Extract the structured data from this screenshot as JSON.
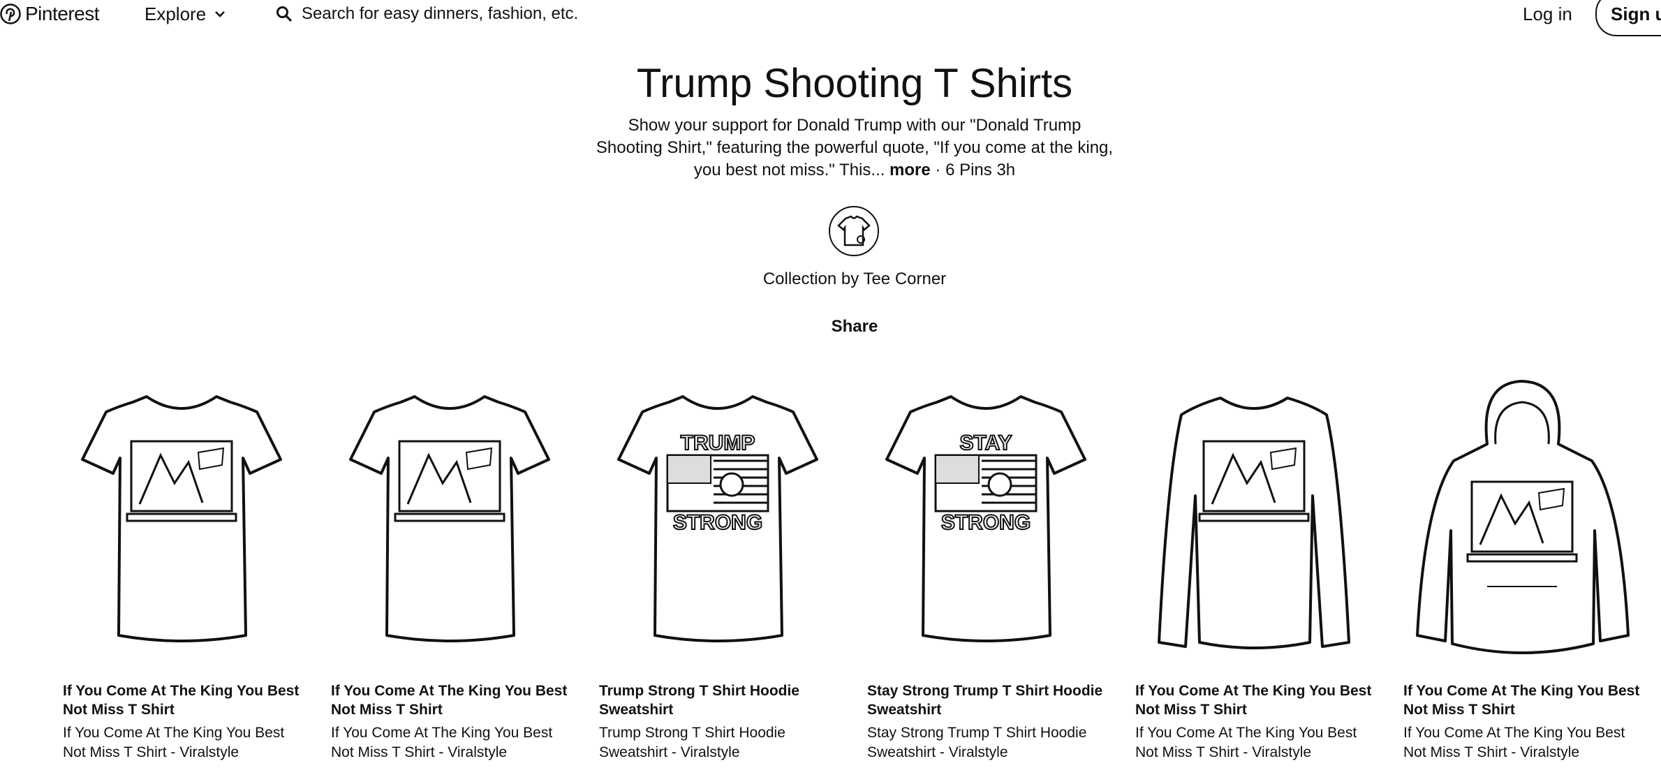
{
  "header": {
    "brand": "Pinterest",
    "explore_label": "Explore",
    "search_placeholder": "Search for easy dinners, fashion, etc.",
    "login_label": "Log in",
    "signup_label": "Sign up"
  },
  "collection": {
    "title": "Trump Shooting T Shirts",
    "description": "Show your support for Donald Trump with our \"Donald Trump Shooting Shirt,\" featuring the powerful quote, \"If you come at the king, you best not miss.\" This...",
    "more_label": "more",
    "meta": "· 6 Pins 3h",
    "byline": "Collection by Tee Corner",
    "share_label": "Share"
  },
  "pins": [
    {
      "title": "If You Come At The King You Best Not Miss T Shirt",
      "subtitle": "If You Come At The King You Best Not Miss T Shirt - Viralstyle",
      "garment": "tshirt",
      "print": "photo"
    },
    {
      "title": "If You Come At The King You Best Not Miss T Shirt",
      "subtitle": "If You Come At The King You Best Not Miss T Shirt - Viralstyle",
      "garment": "tshirt",
      "print": "photo"
    },
    {
      "title": "Trump Strong T Shirt Hoodie Sweatshirt",
      "subtitle": "Trump Strong T Shirt Hoodie Sweatshirt - Viralstyle",
      "garment": "tshirt",
      "print": "flag",
      "print_top": "TRUMP",
      "print_bottom": "STRONG"
    },
    {
      "title": "Stay Strong Trump T Shirt Hoodie Sweatshirt",
      "subtitle": "Stay Strong Trump T Shirt Hoodie Sweatshirt - Viralstyle",
      "garment": "tshirt",
      "print": "flag",
      "print_top": "STAY",
      "print_bottom": "STRONG"
    },
    {
      "title": "If You Come At The King You Best Not Miss T Shirt",
      "subtitle": "If You Come At The King You Best Not Miss T Shirt - Viralstyle",
      "garment": "longsleeve",
      "print": "photo"
    },
    {
      "title": "If You Come At The King You Best Not Miss T Shirt",
      "subtitle": "If You Come At The King You Best Not Miss T Shirt - Viralstyle",
      "garment": "hoodie",
      "print": "photo"
    }
  ],
  "icons": {
    "logo": "pinterest-logo-icon",
    "explore": "chevron-down-icon",
    "search": "search-icon",
    "avatar": "tshirt-avatar-icon"
  },
  "colors": {
    "text": "#111111",
    "background": "#ffffff"
  }
}
